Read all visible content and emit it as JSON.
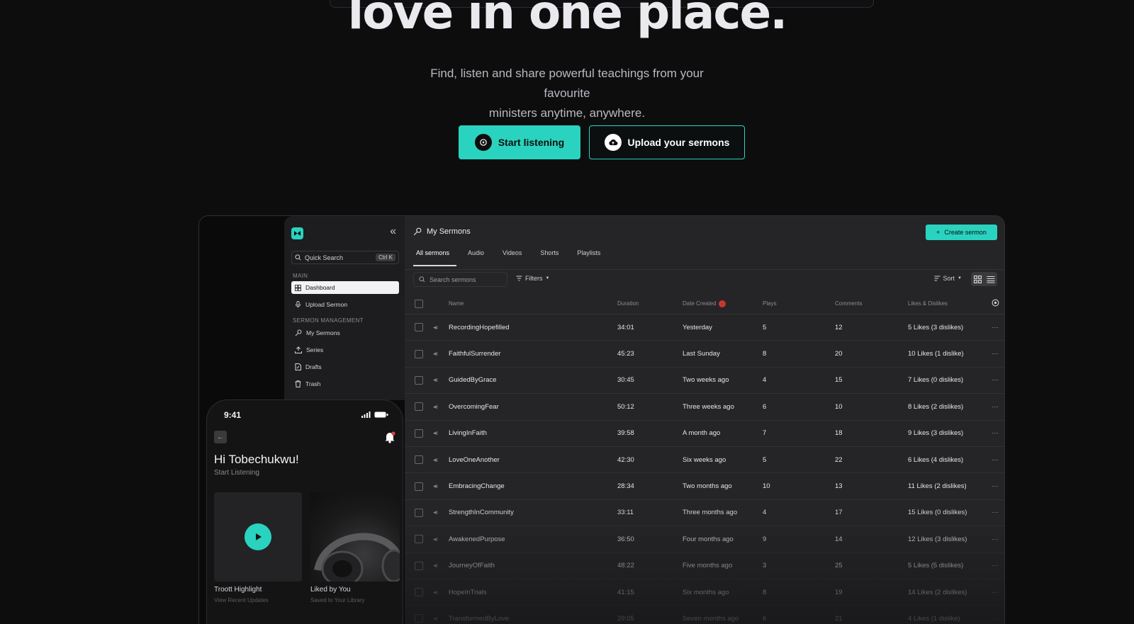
{
  "hero": {
    "title": "love in one place.",
    "subtitle_line1": "Find, listen and share powerful teachings from your favourite",
    "subtitle_line2": "ministers anytime, anywhere.",
    "primary_button": "Start listening",
    "secondary_button": "Upload your sermons"
  },
  "sidebar": {
    "quick_search": "Quick Search",
    "shortcut": "Ctrl K",
    "section_main": "MAIN",
    "section_management": "SERMON MANAGEMENT",
    "items": [
      {
        "label": "Dashboard"
      },
      {
        "label": "Upload Sermon"
      },
      {
        "label": "My Sermons"
      },
      {
        "label": "Series"
      },
      {
        "label": "Drafts"
      },
      {
        "label": "Trash"
      }
    ]
  },
  "main": {
    "title": "My Sermons",
    "create_button": "Create sermon",
    "tabs": [
      "All sermons",
      "Audio",
      "Videos",
      "Shorts",
      "Playlists"
    ],
    "search_placeholder": "Search sermons",
    "filters_label": "Filters",
    "sort_label": "Sort",
    "columns": [
      "Name",
      "Duration",
      "Date Created",
      "Plays",
      "Comments",
      "Likes & Dislikes"
    ],
    "rows": [
      {
        "name": "RecordingHopefilled",
        "duration": "34:01",
        "date": "Yesterday",
        "plays": "5",
        "comments": "12",
        "likes": "5 Likes (3 dislikes)"
      },
      {
        "name": "FaithfulSurrender",
        "duration": "45:23",
        "date": "Last Sunday",
        "plays": "8",
        "comments": "20",
        "likes": "10 Likes (1 dislike)"
      },
      {
        "name": "GuidedByGrace",
        "duration": "30:45",
        "date": "Two weeks ago",
        "plays": "4",
        "comments": "15",
        "likes": "7 Likes (0 dislikes)"
      },
      {
        "name": "OvercomingFear",
        "duration": "50:12",
        "date": "Three weeks ago",
        "plays": "6",
        "comments": "10",
        "likes": "8 Likes (2 dislikes)"
      },
      {
        "name": "LivingInFaith",
        "duration": "39:58",
        "date": "A month ago",
        "plays": "7",
        "comments": "18",
        "likes": "9 Likes (3 dislikes)"
      },
      {
        "name": "LoveOneAnother",
        "duration": "42:30",
        "date": "Six weeks ago",
        "plays": "5",
        "comments": "22",
        "likes": "6 Likes (4 dislikes)"
      },
      {
        "name": "EmbracingChange",
        "duration": "28:34",
        "date": "Two months ago",
        "plays": "10",
        "comments": "13",
        "likes": "11 Likes (2 dislikes)"
      },
      {
        "name": "StrengthInCommunity",
        "duration": "33:11",
        "date": "Three months ago",
        "plays": "4",
        "comments": "17",
        "likes": "15 Likes (0 dislikes)"
      },
      {
        "name": "AwakenedPurpose",
        "duration": "36:50",
        "date": "Four months ago",
        "plays": "9",
        "comments": "14",
        "likes": "12 Likes (3 dislikes)"
      },
      {
        "name": "JourneyOfFaith",
        "duration": "48:22",
        "date": "Five months ago",
        "plays": "3",
        "comments": "25",
        "likes": "5 Likes (5 dislikes)"
      },
      {
        "name": "HopeInTrials",
        "duration": "41:15",
        "date": "Six months ago",
        "plays": "8",
        "comments": "19",
        "likes": "14 Likes (2 dislikes)"
      },
      {
        "name": "TransformedByLove",
        "duration": "29:05",
        "date": "Seven months ago",
        "plays": "6",
        "comments": "21",
        "likes": "4 Likes (1 dislike)"
      }
    ]
  },
  "phone": {
    "time": "9:41",
    "greeting": "Hi Tobechukwu!",
    "subtitle": "Start Listening",
    "card1_title": "Troott Highlight",
    "card1_sub": "View Recent Updates",
    "card2_title": "Liked by You",
    "card2_sub": "Saved to Your Library"
  },
  "colors": {
    "accent": "#2ad3bf",
    "background": "#0d0d0e",
    "badge": "#c9352d"
  }
}
